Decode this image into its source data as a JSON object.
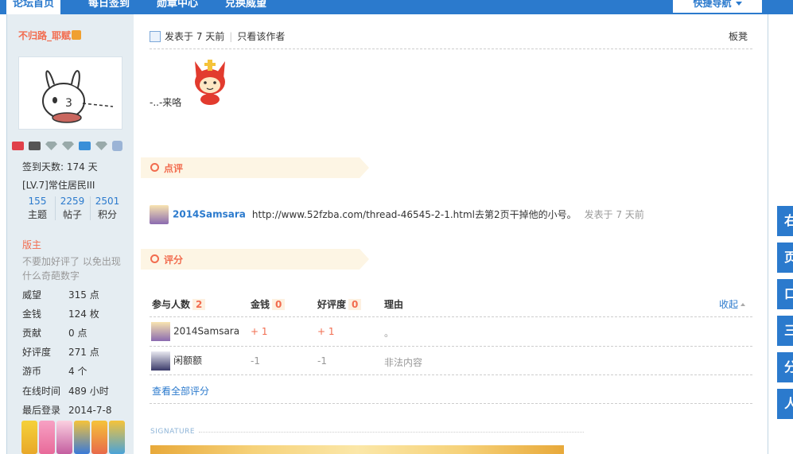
{
  "nav": {
    "tabs": [
      "论坛首页",
      "每日签到",
      "勋章中心",
      "兑换威望"
    ],
    "right_faded": "",
    "quick_nav": "快捷导航"
  },
  "sidebar": {
    "username": "不归路_耶赋",
    "badges_count": 8,
    "checkin": "签到天数: 174 天",
    "level": "[LV.7]常住居民III",
    "stats": [
      {
        "num": "155",
        "label": "主题"
      },
      {
        "num": "2259",
        "label": "帖子"
      },
      {
        "num": "2501",
        "label": "积分"
      }
    ],
    "role": "版主",
    "motto": "不要加好评了 以免出现什么奇葩数字",
    "fields": [
      {
        "k": "威望",
        "v": "315 点"
      },
      {
        "k": "金钱",
        "v": "124 枚"
      },
      {
        "k": "贡献",
        "v": "0 点"
      },
      {
        "k": "好评度",
        "v": "271 点"
      },
      {
        "k": "游币",
        "v": "4 个"
      },
      {
        "k": "在线时间",
        "v": "489 小时"
      },
      {
        "k": "最后登录",
        "v": "2014-7-8"
      }
    ]
  },
  "post": {
    "posted": "发表于 7 天前",
    "only_author": "只看该作者",
    "floor": "板凳",
    "body": "-..-来咯"
  },
  "comment_section": {
    "title": "点评",
    "user": "2014Samsara",
    "text": "http://www.52fzba.com/thread-46545-2-1.html去第2页干掉他的小号。",
    "time": "发表于 7 天前"
  },
  "rating_section": {
    "title": "评分",
    "headers": {
      "participants": "参与人数",
      "participants_count": "2",
      "money": "金钱",
      "money_total": "0",
      "rep": "好评度",
      "rep_total": "0",
      "reason": "理由",
      "collapse": "收起"
    },
    "rows": [
      {
        "user": "2014Samsara",
        "money": "+ 1",
        "rep": "+ 1",
        "reason": "。"
      },
      {
        "user": "闲额额",
        "money": "-1",
        "rep": "-1",
        "reason": "非法内容"
      }
    ],
    "view_all": "查看全部评分"
  },
  "signature_label": "SIGNATURE",
  "colors": {
    "accent": "#2b7acd",
    "highlight": "#f26c4f",
    "sidebar_bg": "#e5edf2",
    "section_bg": "#fdf5e4"
  },
  "right_toolbar": [
    "右",
    "页",
    "口",
    "三",
    "分",
    "人"
  ]
}
